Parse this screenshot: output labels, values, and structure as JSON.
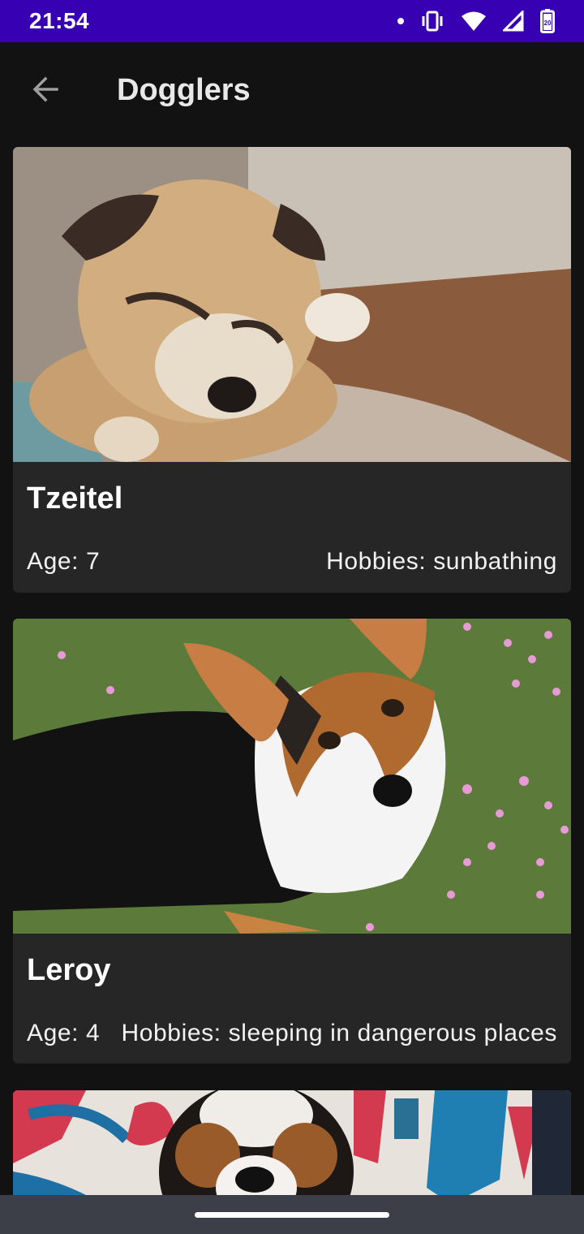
{
  "status_bar": {
    "time": "21:54",
    "icons": [
      "notification-dot-icon",
      "vibrate-icon",
      "wifi-icon",
      "signal-icon",
      "battery-icon"
    ],
    "battery_level": "20"
  },
  "app_bar": {
    "title": "Dogglers",
    "back_icon": "arrow-back-icon"
  },
  "dogs": [
    {
      "name": "Tzeitel",
      "age": "Age: 7",
      "hobbies": "Hobbies: sunbathing",
      "photo": "sleeping pug on couch"
    },
    {
      "name": "Leroy",
      "age": "Age: 4",
      "hobbies": "Hobbies: sleeping in dangerous places",
      "photo": "corgi on grass"
    },
    {
      "name": "",
      "age": "",
      "hobbies": "",
      "photo": "dog in front of graffiti wall"
    }
  ],
  "colors": {
    "status_bar": "#3700b3",
    "background": "#121212",
    "card": "#262626",
    "nav_bar": "#3c3f47"
  }
}
